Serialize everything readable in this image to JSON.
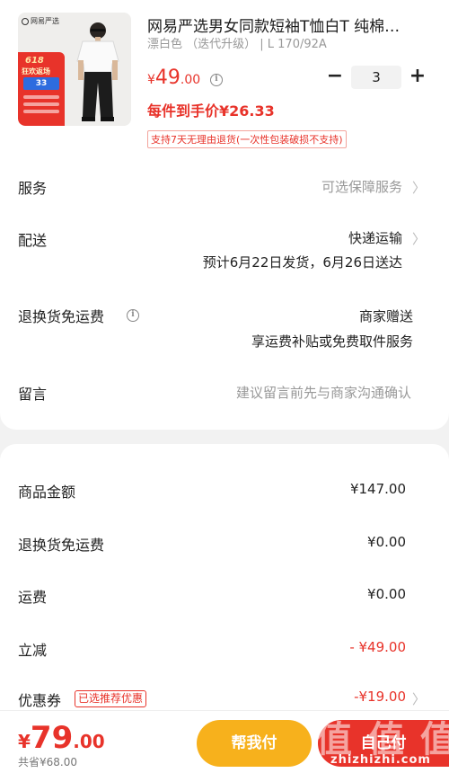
{
  "product": {
    "thumb_brand": "网易严选",
    "thumb_promo": {
      "big": "618",
      "sub": "狂欢返场",
      "badge": "33"
    },
    "title": "网易严选男女同款短袖T恤白T 纯棉…",
    "spec": "漂白色 （迭代升级） | L 170/92A",
    "price_prefix": "¥",
    "price_int": "49",
    "price_dec": ".00",
    "quantity": "3",
    "minus_label": "−",
    "plus_label": "+",
    "final_price_text": "每件到手价¥26.33",
    "return_note": "支持7天无理由退货(一次性包装破损不支持)"
  },
  "rows": {
    "service": {
      "label": "服务",
      "value": "可选保障服务"
    },
    "delivery": {
      "label": "配送",
      "value": "快递运输",
      "sub": "预计6月22日发货，6月26日送达"
    },
    "return_shipping": {
      "label": "退换货免运费",
      "value": "商家赠送",
      "sub": "享运费补贴或免费取件服务"
    },
    "message": {
      "label": "留言",
      "placeholder": "建议留言前先与商家沟通确认"
    }
  },
  "summary": {
    "goods_amount": {
      "label": "商品金额",
      "value": "¥147.00"
    },
    "return_fee": {
      "label": "退换货免运费",
      "value": "¥0.00"
    },
    "shipping": {
      "label": "运费",
      "value": "¥0.00"
    },
    "discount": {
      "label": "立减",
      "value": "- ¥49.00"
    },
    "coupon": {
      "label": "优惠券",
      "tag": "已选推荐优惠",
      "value": "-¥19.00"
    }
  },
  "footer": {
    "total_yen": "¥",
    "total_int": "79",
    "total_dec": ".00",
    "saved": "共省¥68.00",
    "help_pay": "帮我付",
    "self_pay": "自己付"
  },
  "watermark": {
    "text": "值 值 值",
    "url": "zhizhizhi.com"
  },
  "colors": {
    "accent": "#e8332a",
    "help_button": "#f7b11c"
  },
  "icons": [
    "info-icon",
    "chevron-right-icon"
  ]
}
